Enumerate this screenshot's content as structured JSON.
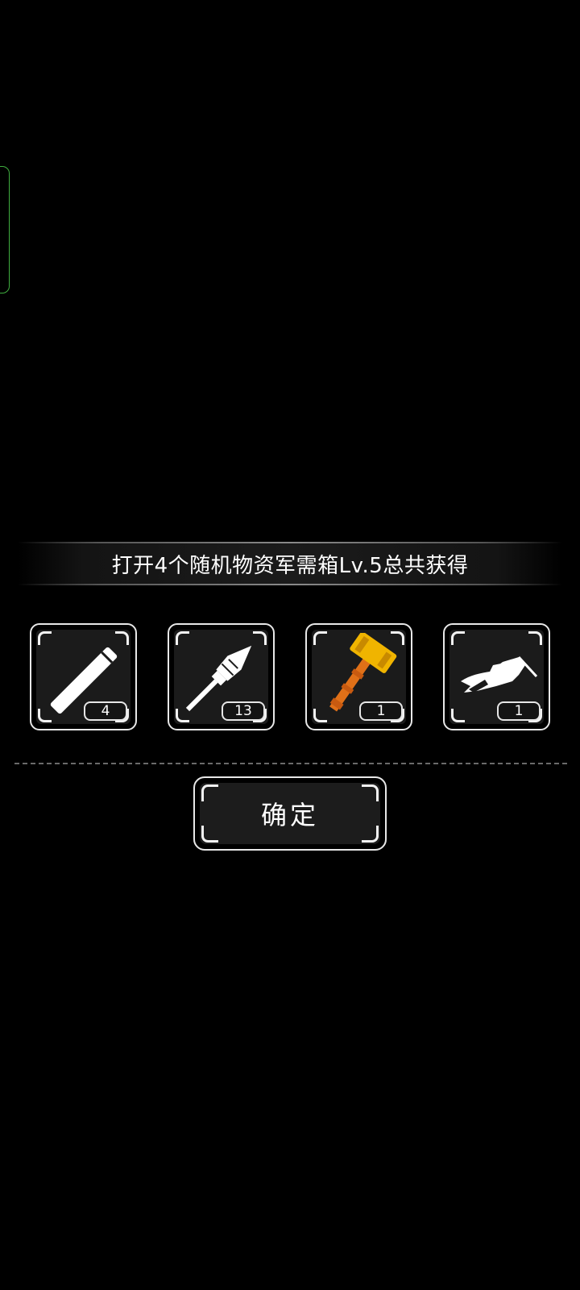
{
  "banner": {
    "title": "打开4个随机物资军需箱Lv.5总共获得"
  },
  "items": [
    {
      "icon": "stick-icon",
      "count": "4",
      "color": "#ffffff"
    },
    {
      "icon": "rocket-warhead-icon",
      "count": "13",
      "color": "#ffffff"
    },
    {
      "icon": "golden-hammer-icon",
      "count": "1",
      "color": "#f0b400"
    },
    {
      "icon": "jet-weapon-icon",
      "count": "1",
      "color": "#ffffff"
    }
  ],
  "confirm": {
    "label": "确定"
  },
  "colors": {
    "background": "#000000",
    "side_tab": "#3fae3f",
    "frame": "#e8e8e8",
    "gold": "#f0b400",
    "orange": "#e07018"
  }
}
